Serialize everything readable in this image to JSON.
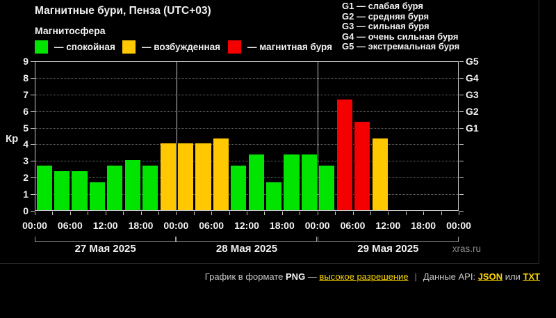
{
  "page": {
    "title": "Магнитные бури, Пенза (UTC+03)",
    "subtitle": "Магнитосфера",
    "watermark": "xras.ru"
  },
  "kp_legend": [
    {
      "label": "— спокойная",
      "level": "quiet"
    },
    {
      "label": "— возбужденная",
      "level": "active"
    },
    {
      "label": "— магнитная буря",
      "level": "storm"
    }
  ],
  "g_legend": [
    "G1 — слабая буря",
    "G2 — средняя буря",
    "G3 — сильная буря",
    "G4 — очень сильная буря",
    "G5 — экстремальная буря"
  ],
  "chart_data": {
    "type": "bar",
    "title": "Магнитные бури, Пенза (UTC+03)",
    "ylabel": "Кр",
    "ylim": [
      0,
      9
    ],
    "y_ticks": [
      0,
      1,
      2,
      3,
      4,
      5,
      6,
      7,
      8,
      9
    ],
    "grid": "dotted-horizontal",
    "hours_per_bar": 3,
    "level_colors": {
      "quiet": "#00e400",
      "active": "#ffc800",
      "storm": "#f40000"
    },
    "right_axis": [
      {
        "label": "G1",
        "kp": 5
      },
      {
        "label": "G2",
        "kp": 6
      },
      {
        "label": "G3",
        "kp": 7
      },
      {
        "label": "G4",
        "kp": 8
      },
      {
        "label": "G5",
        "kp": 9
      }
    ],
    "x_tick_labels": [
      "00:00",
      "06:00",
      "12:00",
      "18:00",
      "00:00",
      "06:00",
      "12:00",
      "18:00",
      "00:00",
      "06:00",
      "12:00",
      "18:00",
      "00:00"
    ],
    "days": [
      {
        "date": "27 Мая 2025",
        "bars": [
          {
            "kp": 2.67,
            "level": "quiet"
          },
          {
            "kp": 2.33,
            "level": "quiet"
          },
          {
            "kp": 2.33,
            "level": "quiet"
          },
          {
            "kp": 1.67,
            "level": "quiet"
          },
          {
            "kp": 2.67,
            "level": "quiet"
          },
          {
            "kp": 3.0,
            "level": "quiet"
          },
          {
            "kp": 2.67,
            "level": "quiet"
          },
          {
            "kp": 4.0,
            "level": "active"
          }
        ]
      },
      {
        "date": "28 Мая 2025",
        "bars": [
          {
            "kp": 4.0,
            "level": "active"
          },
          {
            "kp": 4.0,
            "level": "active"
          },
          {
            "kp": 4.33,
            "level": "active"
          },
          {
            "kp": 2.67,
            "level": "quiet"
          },
          {
            "kp": 3.33,
            "level": "quiet"
          },
          {
            "kp": 1.67,
            "level": "quiet"
          },
          {
            "kp": 3.33,
            "level": "quiet"
          },
          {
            "kp": 3.33,
            "level": "quiet"
          }
        ]
      },
      {
        "date": "29 Мая 2025",
        "bars": [
          {
            "kp": 2.67,
            "level": "quiet"
          },
          {
            "kp": 6.67,
            "level": "storm"
          },
          {
            "kp": 5.33,
            "level": "storm"
          },
          {
            "kp": 4.33,
            "level": "active"
          }
        ]
      }
    ]
  },
  "footer": {
    "parts": [
      {
        "text": "График в формате ",
        "kind": "label"
      },
      {
        "text": "PNG",
        "kind": "strong"
      },
      {
        "text": " — ",
        "kind": "label"
      },
      {
        "text": "высокое разрешение",
        "kind": "link",
        "name": "high-res-link"
      },
      {
        "text": "|",
        "kind": "sep"
      },
      {
        "text": "Данные API: ",
        "kind": "label"
      },
      {
        "text": "JSON",
        "kind": "link",
        "name": "json-api-link",
        "strong": true
      },
      {
        "text": " или ",
        "kind": "label"
      },
      {
        "text": "TXT",
        "kind": "link",
        "name": "txt-api-link",
        "strong": true
      }
    ]
  }
}
